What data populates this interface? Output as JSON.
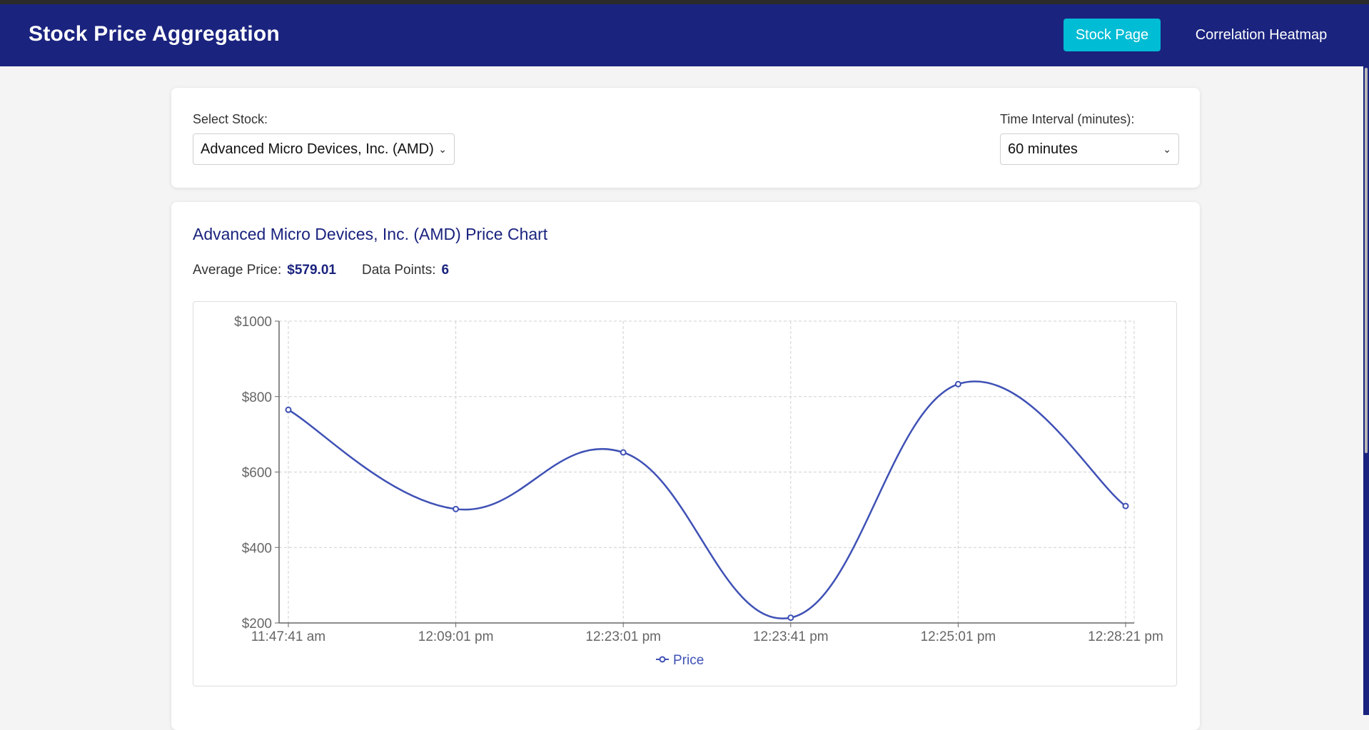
{
  "header": {
    "title": "Stock Price Aggregation",
    "nav": [
      {
        "label": "Stock Page",
        "active": true
      },
      {
        "label": "Correlation Heatmap",
        "active": false
      }
    ]
  },
  "controls": {
    "stock_label": "Select Stock:",
    "stock_value": "Advanced Micro Devices, Inc. (AMD)",
    "interval_label": "Time Interval (minutes):",
    "interval_value": "60 minutes"
  },
  "chart_panel": {
    "title": "Advanced Micro Devices, Inc. (AMD) Price Chart",
    "avg_label": "Average Price:",
    "avg_value": "$579.01",
    "points_label": "Data Points:",
    "points_value": "6"
  },
  "colors": {
    "primary": "#1a237e",
    "accent": "#00bcd4",
    "series": "#3f51b5"
  },
  "chart_data": {
    "type": "line",
    "x": [
      "11:47:41 am",
      "12:09:01 pm",
      "12:23:01 pm",
      "12:23:41 pm",
      "12:25:01 pm",
      "12:28:21 pm"
    ],
    "series": [
      {
        "name": "Price",
        "values": [
          765,
          502,
          652,
          214,
          833,
          510
        ]
      }
    ],
    "ylim": [
      200,
      1000
    ],
    "yticks": [
      200,
      400,
      600,
      800,
      1000
    ],
    "ytick_labels": [
      "$200",
      "$400",
      "$600",
      "$800",
      "$1000"
    ],
    "grid": true,
    "legend": "bottom-center"
  }
}
